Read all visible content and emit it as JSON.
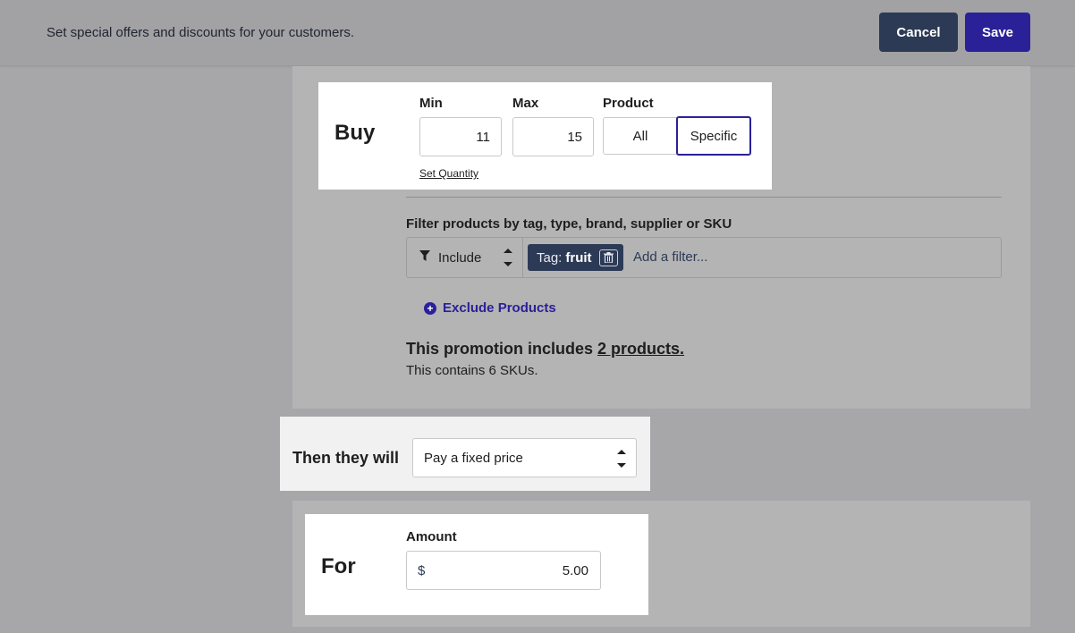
{
  "header": {
    "subtitle": "Set special offers and discounts for your customers.",
    "cancel_label": "Cancel",
    "save_label": "Save"
  },
  "buy": {
    "title": "Buy",
    "min_label": "Min",
    "min_value": "11",
    "max_label": "Max",
    "max_value": "15",
    "product_label": "Product",
    "product_options": [
      "All",
      "Specific"
    ],
    "product_selected": "Specific",
    "set_quantity_label": "Set Quantity"
  },
  "filter": {
    "label": "Filter products by tag, type, brand, supplier or SKU",
    "mode_value": "Include",
    "tag_prefix": "Tag:",
    "tag_value": "fruit",
    "add_placeholder": "Add a filter..."
  },
  "exclude": {
    "label": "Exclude Products"
  },
  "summary": {
    "includes_prefix": "This promotion includes",
    "includes_link": "2 products.",
    "sku_text": "This contains 6 SKUs."
  },
  "then": {
    "label": "Then they will",
    "selected": "Pay a fixed price"
  },
  "for": {
    "title": "For",
    "amount_label": "Amount",
    "currency": "$",
    "amount_value": "5.00"
  },
  "colors": {
    "accent": "#2a2199",
    "navy": "#2c3a55",
    "overlay": "#a7a7a9"
  },
  "icons": {
    "filter": "funnel-icon",
    "trash": "trash-icon",
    "plus": "plus-circle-icon",
    "spinner": "up-down-arrows-icon"
  }
}
